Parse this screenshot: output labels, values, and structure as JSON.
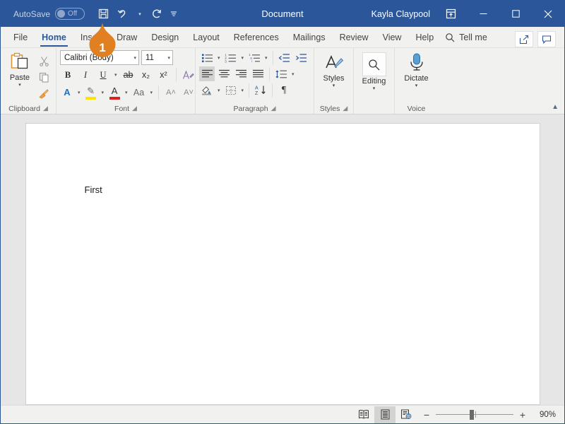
{
  "titlebar": {
    "autosave_label": "AutoSave",
    "autosave_state": "Off",
    "document_title": "Document",
    "user_name": "Kayla Claypool",
    "quick_access": [
      {
        "name": "save-icon",
        "label": "Save"
      },
      {
        "name": "undo-icon",
        "label": "Undo"
      },
      {
        "name": "redo-icon",
        "label": "Redo"
      },
      {
        "name": "customize-quick-access-icon",
        "label": "Customize Quick Access Toolbar"
      }
    ],
    "ribbon_display_options": "Ribbon Display Options",
    "minimize": "Minimize",
    "maximize": "Maximize",
    "close": "Close",
    "accent_color": "#2b579a"
  },
  "tabs": [
    {
      "label": "File",
      "active": false
    },
    {
      "label": "Home",
      "active": true
    },
    {
      "label": "Insert",
      "active": false
    },
    {
      "label": "Draw",
      "active": false
    },
    {
      "label": "Design",
      "active": false
    },
    {
      "label": "Layout",
      "active": false
    },
    {
      "label": "References",
      "active": false
    },
    {
      "label": "Mailings",
      "active": false
    },
    {
      "label": "Review",
      "active": false
    },
    {
      "label": "View",
      "active": false
    },
    {
      "label": "Help",
      "active": false
    }
  ],
  "tellme": {
    "label": "Tell me",
    "icon": "search-icon"
  },
  "tabstrip_right": [
    {
      "name": "share-icon",
      "label": "Share"
    },
    {
      "name": "comments-icon",
      "label": "Comments"
    }
  ],
  "ribbon": {
    "collapse_label": "Collapse the Ribbon",
    "groups": [
      {
        "name": "clipboard",
        "label": "Clipboard",
        "has_launcher": true,
        "paste": {
          "label": "Paste",
          "caret": "▾"
        },
        "items": [
          {
            "name": "cut-icon",
            "label": "Cut"
          },
          {
            "name": "copy-icon",
            "label": "Copy"
          },
          {
            "name": "format-painter-icon",
            "label": "Format Painter"
          }
        ]
      },
      {
        "name": "font",
        "label": "Font",
        "has_launcher": true,
        "font_name": "Calibri (Body)",
        "font_size": "11",
        "buttons_row1": [
          {
            "name": "bold-button",
            "label": "B"
          },
          {
            "name": "italic-button",
            "label": "I"
          },
          {
            "name": "underline-button",
            "label": "U"
          },
          {
            "name": "strikethrough-button",
            "label": "ab"
          },
          {
            "name": "subscript-button",
            "label": "x₂"
          },
          {
            "name": "superscript-button",
            "label": "x²"
          },
          {
            "name": "clear-formatting-button",
            "label": "A"
          }
        ],
        "buttons_row2": [
          {
            "name": "text-effects-button",
            "label": "A",
            "color": "#1f6fc4"
          },
          {
            "name": "text-highlight-button",
            "label": "✎",
            "color": "#ffe400"
          },
          {
            "name": "font-color-button",
            "label": "A",
            "color": "#e02020"
          },
          {
            "name": "change-case-button",
            "label": "Aa"
          },
          {
            "name": "grow-font-button",
            "label": "A˄"
          },
          {
            "name": "shrink-font-button",
            "label": "A˅"
          }
        ]
      },
      {
        "name": "paragraph",
        "label": "Paragraph",
        "has_launcher": true,
        "buttons_row1": [
          {
            "name": "bullets-button",
            "label": "Bullets"
          },
          {
            "name": "numbering-button",
            "label": "Numbering"
          },
          {
            "name": "multilevel-list-button",
            "label": "Multilevel List"
          },
          {
            "name": "decrease-indent-button",
            "label": "Decrease Indent"
          },
          {
            "name": "increase-indent-button",
            "label": "Increase Indent"
          }
        ],
        "buttons_row2": [
          {
            "name": "align-left-button",
            "label": "Align Left",
            "active": true
          },
          {
            "name": "align-center-button",
            "label": "Center",
            "active": false
          },
          {
            "name": "align-right-button",
            "label": "Align Right",
            "active": false
          },
          {
            "name": "justify-button",
            "label": "Justify",
            "active": false
          },
          {
            "name": "line-spacing-button",
            "label": "Line and Paragraph Spacing"
          }
        ],
        "buttons_row3": [
          {
            "name": "shading-button",
            "label": "Shading"
          },
          {
            "name": "borders-button",
            "label": "Borders"
          },
          {
            "name": "sort-button",
            "label": "Sort"
          },
          {
            "name": "show-formatting-marks-button",
            "label": "¶"
          }
        ]
      },
      {
        "name": "styles",
        "label": "Styles",
        "has_launcher": true,
        "button": {
          "name": "styles-button",
          "label": "Styles",
          "caret": "▾"
        }
      },
      {
        "name": "editing",
        "label": "",
        "has_launcher": false,
        "button": {
          "name": "editing-button",
          "label": "Editing",
          "caret": "▾"
        }
      },
      {
        "name": "voice",
        "label": "Voice",
        "has_launcher": false,
        "button": {
          "name": "dictate-button",
          "label": "Dictate",
          "caret": "▾"
        }
      }
    ]
  },
  "document": {
    "body_text": "First"
  },
  "statusbar": {
    "views": [
      {
        "name": "read-mode-button",
        "label": "Read Mode",
        "active": false
      },
      {
        "name": "print-layout-button",
        "label": "Print Layout",
        "active": true
      },
      {
        "name": "web-layout-button",
        "label": "Web Layout",
        "active": false
      }
    ],
    "zoom_out": "−",
    "zoom_in": "+",
    "zoom_level": "90%"
  },
  "annotation": {
    "marker_number": "1",
    "marker_color": "#e08020",
    "target": "save-button"
  }
}
